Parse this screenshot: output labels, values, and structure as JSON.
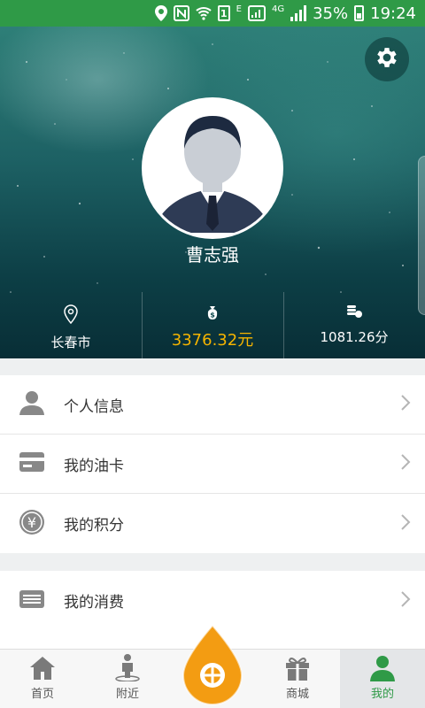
{
  "status_bar": {
    "network_small": "E",
    "sim_label": "1",
    "network_type": "4G",
    "battery": "35%",
    "time": "19:24"
  },
  "profile": {
    "name": "曹志强"
  },
  "stats": [
    {
      "icon": "location-pin-icon",
      "value": "长春市"
    },
    {
      "icon": "money-bag-icon",
      "value": "3376.32元"
    },
    {
      "icon": "coins-icon",
      "value": "1081.26分"
    }
  ],
  "menu": {
    "group1": [
      {
        "label": "个人信息",
        "icon": "person-icon"
      },
      {
        "label": "我的油卡",
        "icon": "card-icon"
      },
      {
        "label": "我的积分",
        "icon": "yen-coin-icon"
      }
    ],
    "group2": [
      {
        "label": "我的消费",
        "icon": "keyboard-icon"
      }
    ]
  },
  "tabs": [
    {
      "label": "首页",
      "icon": "home-icon"
    },
    {
      "label": "附近",
      "icon": "nearby-person-icon"
    },
    {
      "label": "",
      "icon": "fuel-drop-icon"
    },
    {
      "label": "商城",
      "icon": "gift-icon"
    },
    {
      "label": "我的",
      "icon": "profile-icon"
    }
  ],
  "colors": {
    "brand_green": "#2f9a47",
    "money_orange": "#f5b400",
    "center_button": "#f39c12"
  }
}
